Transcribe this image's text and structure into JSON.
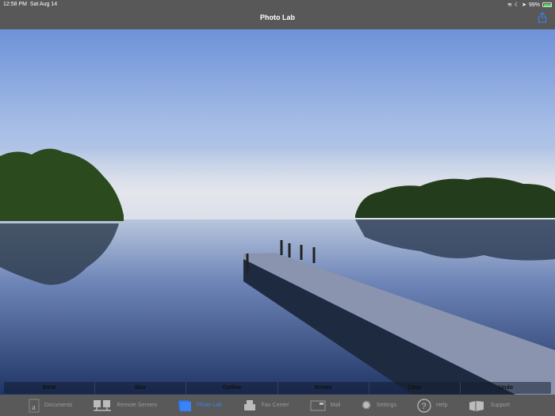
{
  "status": {
    "time": "12:58 PM",
    "date": "Sat Aug 14",
    "battery": "99%"
  },
  "nav": {
    "title": "Photo Lab"
  },
  "toolbar": [
    "B&W",
    "Blur",
    "Outline",
    "Rotate",
    "Clear",
    "Undo"
  ],
  "tabs": [
    {
      "label": "Documents",
      "icon": "document-icon"
    },
    {
      "label": "Remote Servers",
      "icon": "servers-icon"
    },
    {
      "label": "Photo Lab",
      "icon": "photo-icon",
      "active": true
    },
    {
      "label": "Fax Center",
      "icon": "fax-icon"
    },
    {
      "label": "Mail",
      "icon": "mail-icon"
    },
    {
      "label": "Settings",
      "icon": "gear-icon"
    },
    {
      "label": "Help",
      "icon": "help-icon"
    },
    {
      "label": "Support",
      "icon": "support-icon"
    }
  ],
  "colors": {
    "bar": "#585858",
    "accent": "#3b82f6"
  }
}
